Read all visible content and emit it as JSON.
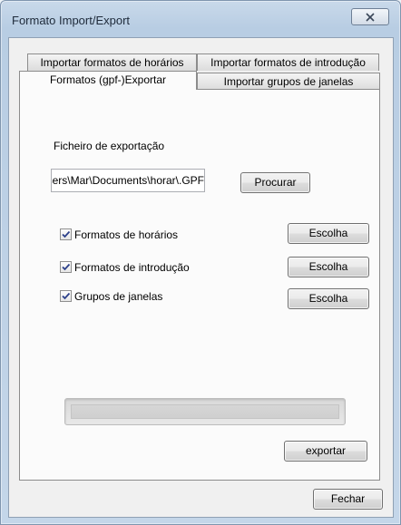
{
  "window": {
    "title": "Formato Import/Export"
  },
  "tabs": [
    {
      "label": "Importar formatos de horários",
      "active": false
    },
    {
      "label": "Importar formatos de introdução",
      "active": false
    },
    {
      "label": "Formatos (gpf-)Exportar",
      "active": true
    },
    {
      "label": "Importar grupos de janelas",
      "active": false
    }
  ],
  "export": {
    "file_label": "Ficheiro de exportação",
    "file_value": "C:\\Users\\Mar\\Documents\\horar\\.GPF",
    "browse_label": "Procurar",
    "options": [
      {
        "label": "Formatos de horários",
        "checked": true,
        "button": "Escolha"
      },
      {
        "label": "Formatos de introdução",
        "checked": true,
        "button": "Escolha"
      },
      {
        "label": "Grupos de janelas",
        "checked": true,
        "button": "Escolha"
      }
    ],
    "progress": 0,
    "export_label": "exportar"
  },
  "footer": {
    "close_label": "Fechar"
  }
}
